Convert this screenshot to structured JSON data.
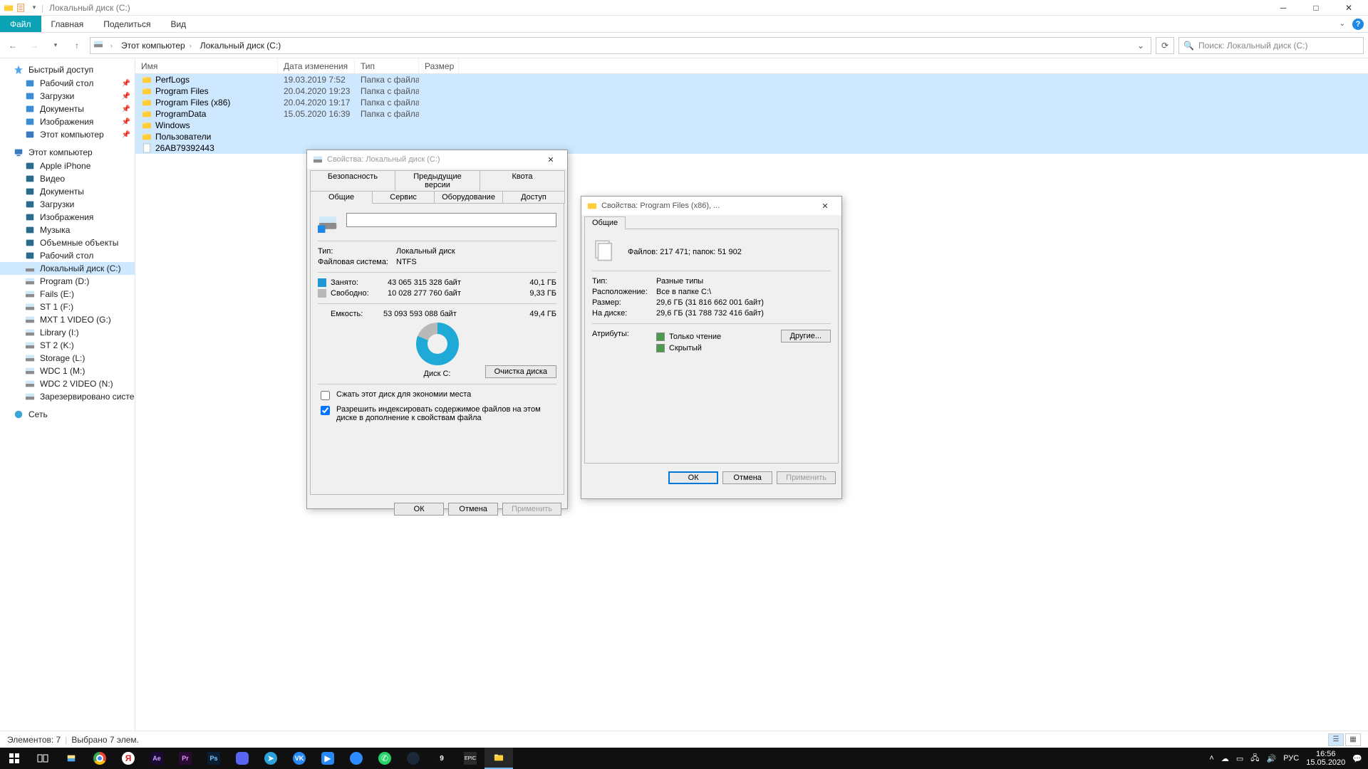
{
  "window": {
    "title": "Локальный диск (C:)",
    "ribbon": {
      "file": "Файл",
      "home": "Главная",
      "share": "Поделиться",
      "view": "Вид"
    },
    "breadcrumb": [
      "Этот компьютер",
      "Локальный диск (C:)"
    ],
    "search_placeholder": "Поиск: Локальный диск (C:)"
  },
  "columns": {
    "name": "Имя",
    "date": "Дата изменения",
    "type": "Тип",
    "size": "Размер"
  },
  "rows": [
    {
      "name": "PerfLogs",
      "date": "19.03.2019 7:52",
      "type": "Папка с файлами",
      "icon": "folder"
    },
    {
      "name": "Program Files",
      "date": "20.04.2020 19:23",
      "type": "Папка с файлами",
      "icon": "folder"
    },
    {
      "name": "Program Files (x86)",
      "date": "20.04.2020 19:17",
      "type": "Папка с файлами",
      "icon": "folder"
    },
    {
      "name": "ProgramData",
      "date": "15.05.2020 16:39",
      "type": "Папка с файлами",
      "icon": "folder"
    },
    {
      "name": "Windows",
      "date": "",
      "type": "",
      "icon": "folder"
    },
    {
      "name": "Пользователи",
      "date": "",
      "type": "",
      "icon": "folder"
    },
    {
      "name": "26AB79392443",
      "date": "",
      "type": "",
      "icon": "file"
    }
  ],
  "nav": {
    "quick": {
      "label": "Быстрый доступ",
      "items": [
        "Рабочий стол",
        "Загрузки",
        "Документы",
        "Изображения",
        "Этот компьютер"
      ]
    },
    "thispc": {
      "label": "Этот компьютер",
      "items": [
        "Apple iPhone",
        "Видео",
        "Документы",
        "Загрузки",
        "Изображения",
        "Музыка",
        "Объемные объекты",
        "Рабочий стол",
        "Локальный диск (C:)",
        "Program (D:)",
        "Fails (E:)",
        "ST 1 (F:)",
        "MXT 1 VIDEO (G:)",
        "Library (I:)",
        "ST 2 (K:)",
        "Storage (L:)",
        "WDC 1 (M:)",
        "WDC 2 VIDEO (N:)",
        "Зарезервировано системой"
      ]
    },
    "network": {
      "label": "Сеть"
    }
  },
  "status": {
    "count": "Элементов: 7",
    "sel": "Выбрано 7 элем."
  },
  "dlg1": {
    "title": "Свойства: Локальный диск (C:)",
    "tabs_top": [
      "Безопасность",
      "Предыдущие версии",
      "Квота"
    ],
    "tabs_bot": [
      "Общие",
      "Сервис",
      "Оборудование",
      "Доступ"
    ],
    "type_k": "Тип:",
    "type_v": "Локальный диск",
    "fs_k": "Файловая система:",
    "fs_v": "NTFS",
    "used_k": "Занято:",
    "used_b": "43 065 315 328 байт",
    "used_g": "40,1 ГБ",
    "free_k": "Свободно:",
    "free_b": "10 028 277 760 байт",
    "free_g": "9,33 ГБ",
    "cap_k": "Емкость:",
    "cap_b": "53 093 593 088 байт",
    "cap_g": "49,4 ГБ",
    "disklabel": "Диск C:",
    "cleanup": "Очистка диска",
    "compress": "Сжать этот диск для экономии места",
    "index": "Разрешить индексировать содержимое файлов на этом диске в дополнение к свойствам файла",
    "ok": "ОК",
    "cancel": "Отмена",
    "apply": "Применить"
  },
  "dlg2": {
    "title": "Свойства: Program Files (x86), ...",
    "tab": "Общие",
    "summary": "Файлов: 217 471; папок: 51 902",
    "type_k": "Тип:",
    "type_v": "Разные типы",
    "loc_k": "Расположение:",
    "loc_v": "Все в папке C:\\",
    "size_k": "Размер:",
    "size_v": "29,6 ГБ (31 816 662 001 байт)",
    "ondisk_k": "На диске:",
    "ondisk_v": "29,6 ГБ (31 788 732 416 байт)",
    "attr_k": "Атрибуты:",
    "ro": "Только чтение",
    "hidden": "Скрытый",
    "other": "Другие...",
    "ok": "ОК",
    "cancel": "Отмена",
    "apply": "Применить"
  },
  "tray": {
    "lang": "РУС",
    "time": "16:56",
    "date": "15.05.2020"
  }
}
